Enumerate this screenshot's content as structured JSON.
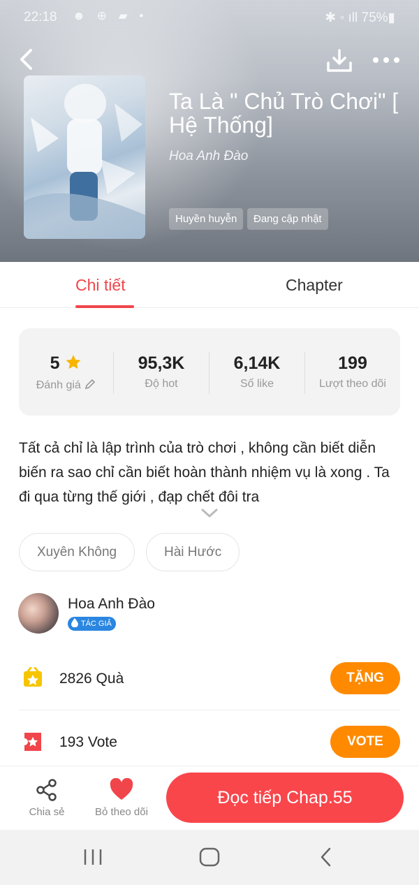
{
  "status_bar": {
    "time": "22:18",
    "icons": "☻ ⊕ ▰ •",
    "right": "✱ ◦ ıll 75%▮"
  },
  "book": {
    "title": "Ta Là \" Chủ Trò Chơi\" [ Hệ Thống]",
    "author": "Hoa Anh Đào",
    "tags": [
      "Huyền huyễn",
      "Đang cập nhật"
    ]
  },
  "tabs": {
    "details": "Chi tiết",
    "chapter": "Chapter"
  },
  "stats": [
    {
      "value": "5",
      "label": "Đánh giá"
    },
    {
      "value": "95,3K",
      "label": "Độ hot"
    },
    {
      "value": "6,14K",
      "label": "Số like"
    },
    {
      "value": "199",
      "label": "Lượt theo dõi"
    }
  ],
  "description": "Tất cả chỉ là lập trình của trò chơi , không cần biết diễn biến ra sao chỉ cần biết hoàn thành nhiệm vụ là xong . Ta đi qua  từng thế giới , đạp chết đôi tra",
  "genres": [
    "Xuyên Không",
    "Hài Hước"
  ],
  "author_card": {
    "name": "Hoa Anh Đào",
    "badge": "TÁC GIẢ"
  },
  "gifts": {
    "text": "2826  Quà",
    "button": "TẶNG"
  },
  "votes": {
    "text": "193  Vote",
    "button": "VOTE"
  },
  "bottom_bar": {
    "share": "Chia sẻ",
    "unfollow": "Bỏ theo dõi",
    "read": "Đọc tiếp Chap.55"
  },
  "colors": {
    "accent": "#f0454a",
    "orange": "#ff8a00",
    "read_button": "#f9464b"
  }
}
